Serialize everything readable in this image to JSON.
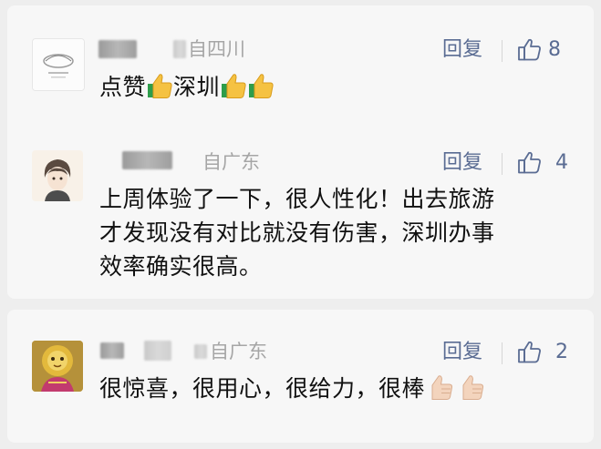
{
  "comments": [
    {
      "region": "自四川",
      "reply": "回复",
      "likes": "8",
      "content": {
        "part1": "点赞",
        "emoji1": "thumbs-up-emoji",
        "part2": "深圳",
        "emoji2": "thumbs-up-emoji",
        "emoji3": "thumbs-up-emoji"
      }
    },
    {
      "region": "自广东",
      "reply": "回复",
      "likes": "4",
      "content": {
        "line1": "上周体验了一下，很人性化！出去旅游",
        "line2": "才发现没有对比就没有伤害，深圳办事",
        "line3": "效率确实很高。"
      }
    },
    {
      "region": "自广东",
      "reply": "回复",
      "likes": "2",
      "content": {
        "text": "很惊喜，很用心，很给力，很棒",
        "emoji1": "thumbs-up-light-emoji",
        "emoji2": "thumbs-up-light-emoji"
      }
    }
  ],
  "colors": {
    "background": "#eeeeee",
    "card": "#f7f7f7",
    "link": "#5a6c93",
    "region_gray": "#a6a6a6",
    "text": "#111111",
    "emoji_yellow": "#f5c242",
    "emoji_cuff": "#2e9d4b",
    "emoji_light": "#f3d4bd"
  }
}
